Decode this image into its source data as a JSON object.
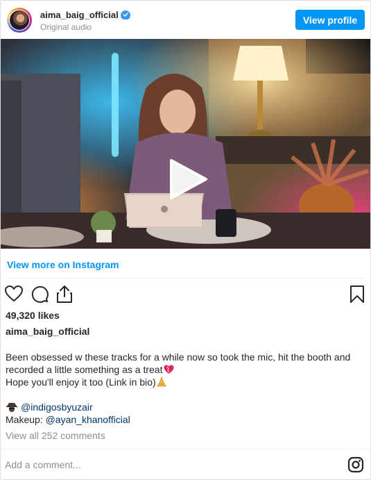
{
  "header": {
    "username": "aima_baig_official",
    "subtitle": "Original audio",
    "view_profile_label": "View profile"
  },
  "video": {
    "play_icon": "play-icon"
  },
  "view_more_label": "View more on Instagram",
  "actions": {
    "icons": [
      "heart-icon",
      "comment-icon",
      "share-icon",
      "bookmark-icon"
    ]
  },
  "likes": "49,320 likes",
  "caption": {
    "username": "aima_baig_official",
    "line1": "Been obsessed w these tracks for a while now so took the mic, hit the booth and",
    "line2": "recorded a little something as a treat",
    "line3": "Hope you'll enjoy it too (Link in bio)",
    "credit1_mention": "@indigosbyuzair",
    "credit2_label": "Makeup: ",
    "credit2_mention": "@ayan_khanofficial"
  },
  "view_comments": "View all 252 comments",
  "comment": {
    "placeholder": "Add a comment..."
  },
  "colors": {
    "accent": "#0095f6",
    "mention": "#00376b",
    "muted": "#8e8e8e"
  }
}
